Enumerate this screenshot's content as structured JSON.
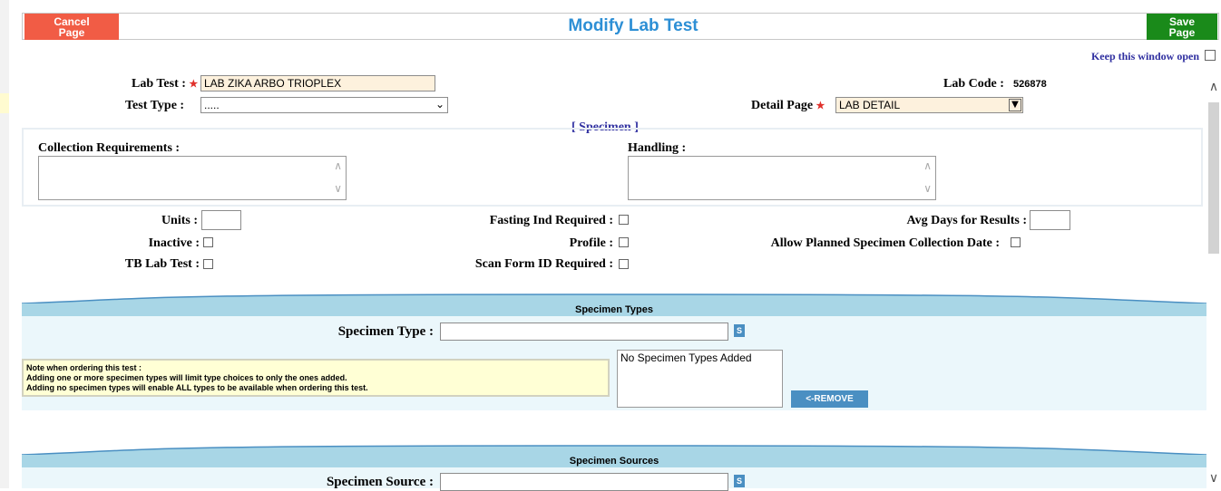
{
  "header": {
    "title": "Modify Lab Test",
    "cancel_label": "Cancel\nPage",
    "save_label": "Save\nPage",
    "keep_open_label": "Keep this window open"
  },
  "form": {
    "lab_test_label": "Lab Test :",
    "lab_test_value": "LAB ZIKA ARBO TRIOPLEX",
    "test_type_label": "Test Type :",
    "test_type_value": ".....",
    "lab_code_label": "Lab Code :",
    "lab_code_value": "526878",
    "detail_page_label": "Detail Page",
    "detail_page_value": "LAB DETAIL"
  },
  "specimen_link": "[ Specimen ]",
  "requirements": {
    "collection_label": "Collection Requirements :",
    "handling_label": "Handling :"
  },
  "options": {
    "units_label": "Units :",
    "inactive_label": "Inactive :",
    "tb_lab_test_label": "TB Lab Test :",
    "fasting_label": "Fasting Ind Required :",
    "profile_label": "Profile :",
    "scan_form_label": "Scan Form ID Required :",
    "avg_days_label": "Avg Days for Results :",
    "allow_planned_label": "Allow Planned Specimen Collection Date :"
  },
  "specimen_types": {
    "header": "Specimen Types",
    "type_label": "Specimen Type :",
    "search_btn": "S",
    "note_lines": [
      "Note when ordering this test :",
      "Adding one or more specimen types will limit type choices to only the ones added.",
      "Adding no specimen types will enable ALL types to be available when ordering this test."
    ],
    "list_empty": "No Specimen Types Added",
    "remove_btn": "<-REMOVE"
  },
  "specimen_sources": {
    "header": "Specimen Sources",
    "source_label": "Specimen Source :",
    "search_btn": "S"
  },
  "colors": {
    "cancel": "#f15c45",
    "save": "#1a8a1a",
    "title": "#2d8fd5",
    "section_header": "#a8d6e6",
    "section_body": "#ebf7fb",
    "required_field": "#fdf1dd",
    "note_bg": "#ffffd5"
  }
}
